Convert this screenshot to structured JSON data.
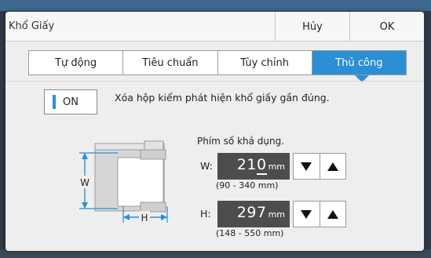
{
  "dialog": {
    "title": "Khổ Giấy",
    "cancel_label": "Hủy",
    "ok_label": "OK"
  },
  "tabs": [
    {
      "label": "Tự động",
      "active": false
    },
    {
      "label": "Tiêu chuẩn",
      "active": false
    },
    {
      "label": "Tùy chỉnh",
      "active": false
    },
    {
      "label": "Thủ công",
      "active": true
    }
  ],
  "detect_toggle": {
    "state_label": "ON",
    "description": "Xóa hộp kiểm phát hiện khổ giấy gần đúng."
  },
  "diagram": {
    "width_label": "W",
    "height_label": "H"
  },
  "input_hint": "Phím số khả dụng.",
  "width_field": {
    "label": "W:",
    "value_prefix": "21",
    "value_cursor_digit": "0",
    "unit": "mm",
    "range": "(90 - 340 mm)"
  },
  "height_field": {
    "label": "H:",
    "value": "297",
    "unit": "mm",
    "range": "(148 - 550 mm)"
  },
  "colors": {
    "accent": "#2b8fd6",
    "display_bg": "#4d4d4d",
    "dialog_bg": "#eeeeee"
  }
}
